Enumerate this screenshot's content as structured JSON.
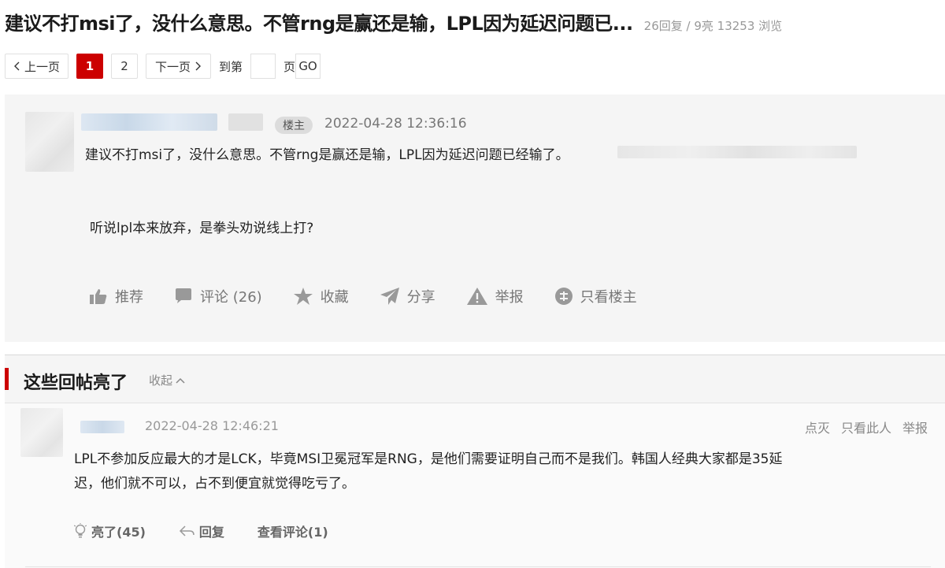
{
  "thread": {
    "title": "建议不打msi了，没什么意思。不管rng是赢还是输，LPL因为延迟问题已...",
    "stats": "26回复 / 9亮 13253 浏览"
  },
  "pager": {
    "prev_label": "上一页",
    "pages": [
      "1",
      "2"
    ],
    "current_page": "1",
    "next_label": "下一页",
    "goto_prefix": "到第",
    "goto_input_value": "",
    "goto_suffix": "页",
    "go_label": "GO"
  },
  "post": {
    "op_badge": "楼主",
    "time": "2022-04-28 12:36:16",
    "line1": "建议不打msi了，没什么意思。不管rng是赢还是输，LPL因为延迟问题已经输了。",
    "line2": "听说lpl本来放弃，是拳头劝说线上打?",
    "actions": {
      "recommend": "推荐",
      "comment": "评论 (26)",
      "favorite": "收藏",
      "share": "分享",
      "report": "举报",
      "op_only": "只看楼主"
    }
  },
  "highlights": {
    "title": "这些回帖亮了",
    "collapse_label": "收起",
    "reply": {
      "time": "2022-04-28 12:46:21",
      "ops": {
        "dislike": "点灭",
        "only_this": "只看此人",
        "report": "举报"
      },
      "text": "LPL不参加反应最大的才是LCK，毕竟MSI卫冕冠军是RNG，是他们需要证明自己而不是我们。韩国人经典大家都是35延迟，他们就不可以，占不到便宜就觉得吃亏了。",
      "actions": {
        "light": "亮了(45)",
        "reply": "回复",
        "view_comments": "查看评论(1)"
      }
    }
  },
  "colors": {
    "accent_red": "#cc0000",
    "panel_bg": "#f5f5f5",
    "muted_text": "#999999"
  }
}
